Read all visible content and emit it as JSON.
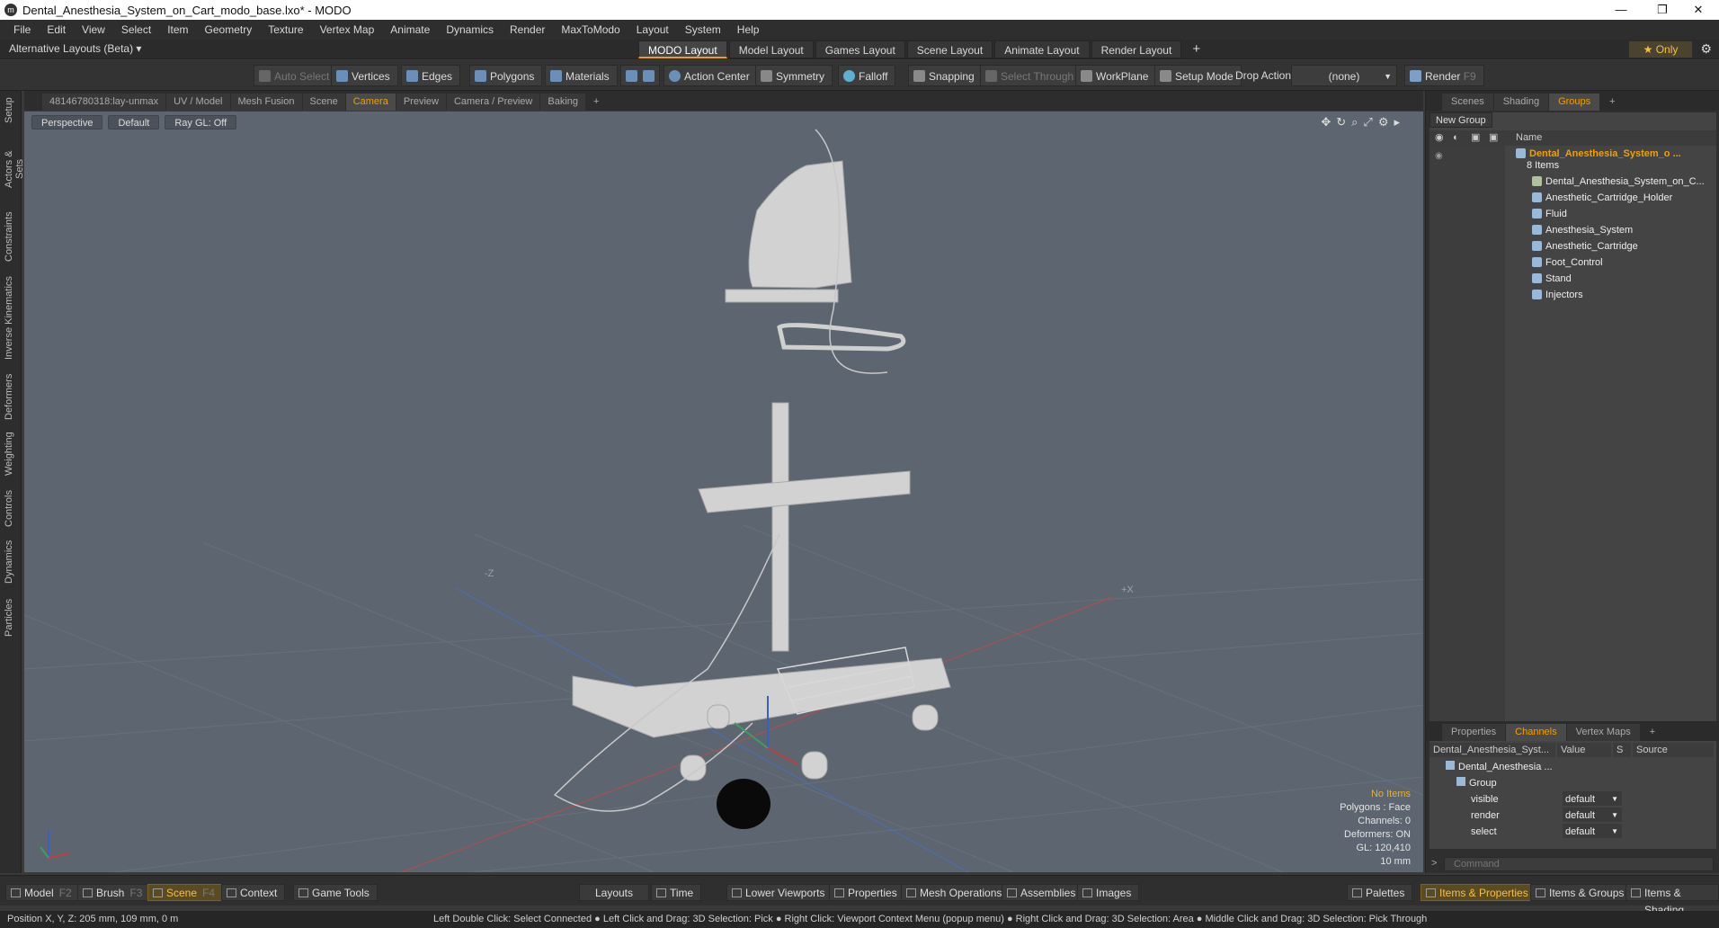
{
  "window": {
    "title": "Dental_Anesthesia_System_on_Cart_modo_base.lxo* - MODO",
    "minimize": "—",
    "restore": "❐",
    "close": "✕"
  },
  "menu": [
    "File",
    "Edit",
    "View",
    "Select",
    "Item",
    "Geometry",
    "Texture",
    "Vertex Map",
    "Animate",
    "Dynamics",
    "Render",
    "MaxToModo",
    "Layout",
    "System",
    "Help"
  ],
  "layout_bar": {
    "alternative": "Alternative Layouts (Beta) ▾",
    "tabs": [
      "MODO Layout",
      "Model Layout",
      "Games Layout",
      "Scene Layout",
      "Animate Layout",
      "Render Layout"
    ],
    "active_tab": "MODO Layout",
    "add": "+",
    "only": "★ Only"
  },
  "toolbar": {
    "auto_select": "Auto Select",
    "vertices": "Vertices",
    "edges": "Edges",
    "polygons": "Polygons",
    "materials": "Materials",
    "action_center": "Action Center",
    "symmetry": "Symmetry",
    "falloff": "Falloff",
    "snapping": "Snapping",
    "select_through": "Select Through",
    "workplane": "WorkPlane",
    "setup_mode": "Setup Mode",
    "drop_action_label": "Drop Action",
    "drop_action_value": "(none)",
    "render": "Render",
    "render_key": "F9"
  },
  "viewport_tabs": [
    "48146780318:lay-unmax",
    "UV / Model",
    "Mesh Fusion",
    "Scene",
    "Camera",
    "Preview",
    "Camera / Preview",
    "Baking",
    "+"
  ],
  "viewport_active_tab": "Camera",
  "left_tabs": [
    "Setup",
    "Actors & Sets",
    "Constraints",
    "Inverse Kinematics",
    "Deformers",
    "Weighting",
    "Controls",
    "Dynamics",
    "Particles"
  ],
  "viewport": {
    "view": "Perspective",
    "shading": "Default",
    "raygl": "Ray GL: Off",
    "axis_neg_z": "-Z",
    "axis_pos_x": "+X",
    "info": {
      "no_items": "No Items",
      "polygons": "Polygons : Face",
      "channels": "Channels: 0",
      "deformers": "Deformers: ON",
      "gl": "GL: 120,410",
      "scale": "10 mm"
    }
  },
  "right_panel": {
    "top_tabs": [
      "Scenes",
      "Shading",
      "Groups",
      "+"
    ],
    "top_active": "Groups",
    "new_group": "New Group",
    "name_header": "Name",
    "group_root": "Dental_Anesthesia_System_o ...",
    "group_count": "8 Items",
    "items": [
      "Dental_Anesthesia_System_on_C...",
      "Anesthetic_Cartridge_Holder",
      "Fluid",
      "Anesthesia_System",
      "Anesthetic_Cartridge",
      "Foot_Control",
      "Stand",
      "Injectors"
    ],
    "bottom_tabs": [
      "Properties",
      "Channels",
      "Vertex Maps",
      "+"
    ],
    "bottom_active": "Channels",
    "channels": {
      "col_name": "Dental_Anesthesia_Syst...",
      "col_value": "Value",
      "col_s": "S",
      "col_source": "Source",
      "root": "Dental_Anesthesia ...",
      "group": "Group",
      "rows": [
        {
          "name": "visible",
          "value": "default"
        },
        {
          "name": "render",
          "value": "default"
        },
        {
          "name": "select",
          "value": "default"
        }
      ]
    },
    "command_placeholder": "Command"
  },
  "bottom_bar": {
    "model": "Model",
    "model_key": "F2",
    "brush": "Brush",
    "brush_key": "F3",
    "scene": "Scene",
    "scene_key": "F4",
    "context": "Context",
    "game_tools": "Game Tools",
    "layouts": "Layouts",
    "time": "Time",
    "lower_viewports": "Lower Viewports",
    "properties": "Properties",
    "mesh_operations": "Mesh Operations",
    "assemblies": "Assemblies",
    "images": "Images",
    "palettes": "Palettes",
    "items_properties": "Items & Properties",
    "items_groups": "Items & Groups",
    "items_shading": "Items & Shading"
  },
  "status": {
    "position": "Position X, Y, Z:  205 mm, 109 mm, 0 m",
    "hints": "Left Double Click: Select Connected ● Left Click and Drag: 3D Selection: Pick ● Right Click: Viewport Context Menu (popup menu) ● Right Click and Drag: 3D Selection: Area ● Middle Click and Drag: 3D Selection: Pick Through"
  }
}
